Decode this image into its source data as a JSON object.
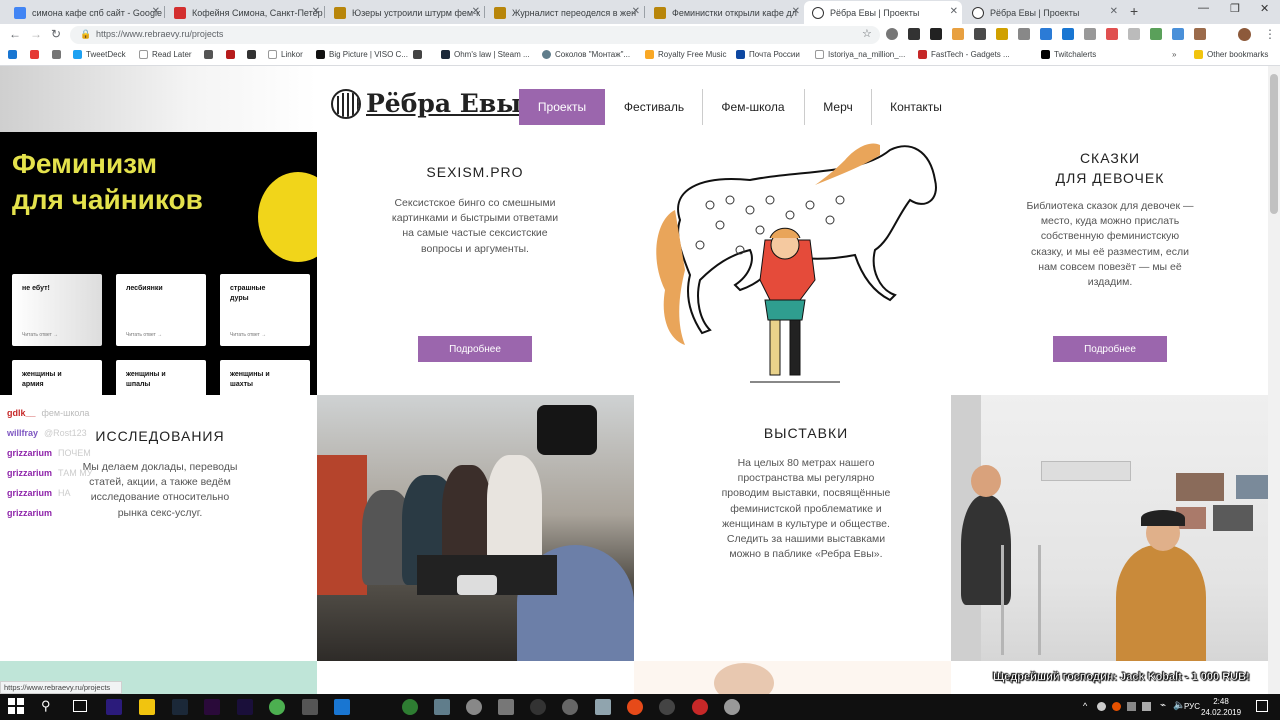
{
  "browser": {
    "tabs": [
      {
        "title": "симона кафе спб сайт - Google",
        "color": "#4285f4"
      },
      {
        "title": "Кофейня Симона, Санкт-Петер",
        "color": "#d32f2f"
      },
      {
        "title": "Юзеры устроили штурм фем-к",
        "color": "#b8860b"
      },
      {
        "title": "Журналист переоделся в жен",
        "color": "#b8860b"
      },
      {
        "title": "Феминистки открыли кафе дл",
        "color": "#b8860b"
      },
      {
        "title": "Рёбра Евы | Проекты",
        "color": "#333333"
      },
      {
        "title": "Рёбра Евы | Проекты",
        "color": "#333333"
      }
    ],
    "new_tab": "+",
    "url": "https://www.rebraevy.ru/projects",
    "bookmarks": [
      "TweetDeck",
      "Read Later",
      "Linkor",
      "Big Picture | VISO C...",
      "Ohm's law | Steam ...",
      "Соколов \"Монтаж\"...",
      "Royalty Free Music",
      "Почта России",
      "Istoriya_na_million_...",
      "FastTech - Gadgets ...",
      "Twitchalerts",
      "Other bookmarks"
    ],
    "status_url": "https://www.rebraevy.ru/projects"
  },
  "site": {
    "logo": "Рёбра Евы",
    "nav": [
      "Проекты",
      "Фестиваль",
      "Фем-школа",
      "Мерч",
      "Контакты"
    ],
    "feminism_card": {
      "title_line1": "Феминизм",
      "title_line2": "для чайников",
      "tiles": [
        {
          "label": "не ебут!",
          "more": "Читать ответ →"
        },
        {
          "label": "лесбиянки",
          "more": "Читать ответ →"
        },
        {
          "label": "страшные дуры",
          "more": "Читать ответ →"
        },
        {
          "label": "женщины и армия",
          "more": ""
        },
        {
          "label": "женщины и шпалы",
          "more": ""
        },
        {
          "label": "женщины и шахты",
          "more": ""
        }
      ]
    },
    "sexism": {
      "title": "SEXISM.PRO",
      "text": "Сексистское бинго со смешными картинками и быстрыми ответами на самые частые сексистские вопросы и аргументы.",
      "button": "Подробнее"
    },
    "tales": {
      "title_line1": "СКАЗКИ",
      "title_line2": "ДЛЯ ДЕВОЧЕК",
      "text": "Библиотека сказок для девочек — место, куда можно прислать собственную феминистскую сказку, и мы её разместим, если нам совсем повезёт — мы её издадим.",
      "button": "Подробнее"
    },
    "research": {
      "title": "ИССЛЕДОВАНИЯ",
      "text": "Мы делаем доклады, переводы статей, акции, а также ведём исследование относительно рынка секс-услуг."
    },
    "exhibitions": {
      "title": "ВЫСТАВКИ",
      "text": "На целых 80 метрах нашего пространства мы регулярно проводим выставки, посвящённые феминистской проблематике и женщинам в культуре и обществе.  Следить за нашими выставками можно в паблике «Ребра Евы»."
    }
  },
  "chat": [
    {
      "user": "gdlk__",
      "msg": "фем-школа",
      "color": "#c62828"
    },
    {
      "user": "willfray",
      "msg": "@Rost123",
      "color": "#7e57c2"
    },
    {
      "user": "grizzarium",
      "msg": "ПОЧЕМ",
      "color": "#8e24aa"
    },
    {
      "user": "grizzarium",
      "msg": "ТАМ МУ",
      "color": "#8e24aa"
    },
    {
      "user": "grizzarium",
      "msg": "НА",
      "color": "#8e24aa"
    },
    {
      "user": "grizzarium",
      "msg": "",
      "color": "#8e24aa"
    }
  ],
  "donation": "Щедрейший господин: Jack Kobalt - 1 000 RUB!",
  "taskbar": {
    "lang": "РУС",
    "time": "2:48",
    "date": "24.02.2019"
  },
  "colors": {
    "accent": "#9b66ad",
    "fem_yellow": "#e4e24c"
  }
}
